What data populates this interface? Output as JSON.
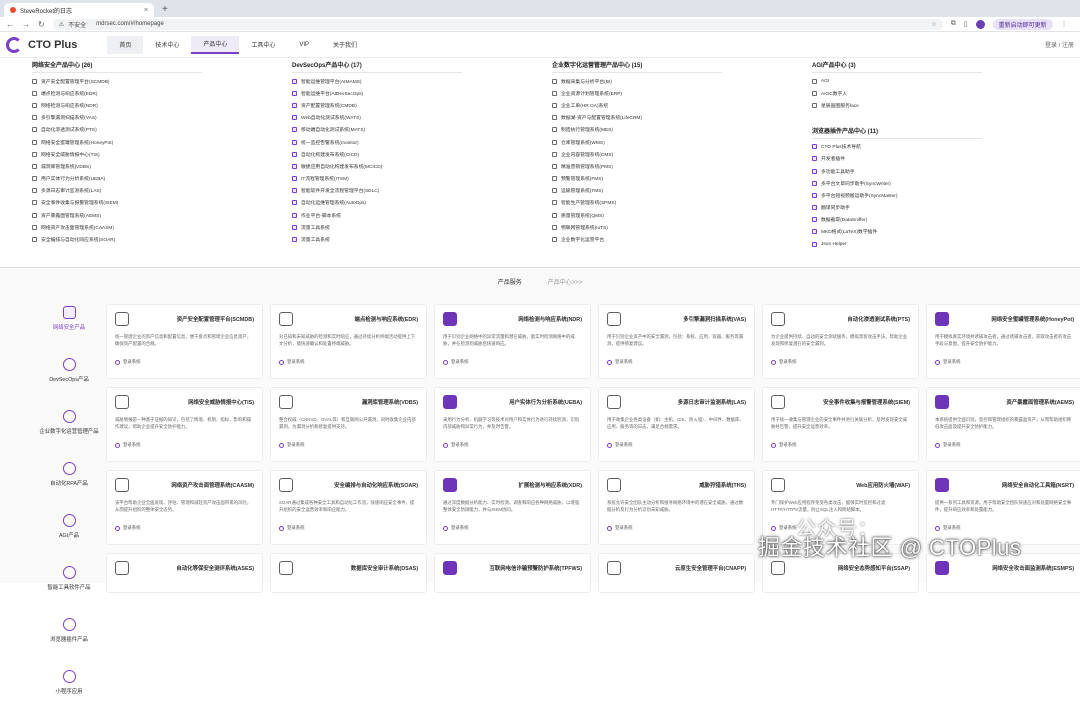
{
  "browser": {
    "tab_title": "SteveRocket的日志",
    "new_tab": "+",
    "security": "不安全",
    "url": "mdrsec.com/#/homepage",
    "update_label": "重新启动即可更新"
  },
  "header": {
    "logo_text": "CTO Plus",
    "menu": [
      "首页",
      "技术中心",
      "产品中心",
      "工具中心",
      "VIP",
      "关于我们"
    ],
    "auth": "登录 / 注册"
  },
  "mega": {
    "col1": {
      "title": "网络安全产品中心 (26)",
      "items": [
        "资产安全配置管理平台(SCMDB)",
        "端点检测与响应系统(EDR)",
        "网络检测与响应系统(NDR)",
        "多引擎漏洞扫描系统(VAS)",
        "自动化渗透测试系统(PTS)",
        "网络安全蜜罐管理系统(HoneyPot)",
        "网络安全威胁情报中心(TIS)",
        "漏洞库管理系统(VDBS)",
        "用户实体行为分析系统(UEBA)",
        "多源日志审计监测系统(LAS)",
        "安全事件收集与报警管理系统(SIEM)",
        "资产暴露面管理系统(AEMS)",
        "网络资产攻击面管理系统(CAASM)",
        "安全编排与自动化响应系统(SOAR)"
      ]
    },
    "col2": {
      "title": "DevSecOps产品中心 (17)",
      "items": [
        "智能运维管理平台(AIMAMS)",
        "智能运维平台(AIDevSecOps)",
        "资产配置管理系统(CMDB)",
        "Web自动化测试系统(WATS)",
        "移动端自动化测试系统(MATS)",
        "统一监控告警系统(monitor)",
        "自动化构建发布系统(CICD)",
        "敏捷应用自动化构建发布系统(MCICD)",
        "IT流程管理系统(ITSM)",
        "智能软件开发全流程管理平台(SDLC)",
        "自动化运维管理系统(AutoOps)",
        "作业平台-脚本系统",
        "流量工具系统",
        "流量工具系统"
      ]
    },
    "col3": {
      "title": "企业数字化运营管理产品中心 (15)",
      "items": [
        "数据采集与分析平台(BI)",
        "企业资源计划管理系统(ERP)",
        "企业工单(HR OA)系统",
        "数据湖-资产与配置管理系统(LifeCRM)",
        "制造执行管理系统(MES)",
        "仓库管理系统(WMS)",
        "企业内容管理系统(CMS)",
        "精准营销管理系统(PMS)",
        "预警管理系统(FMS)",
        "运输管理系统(TMS)",
        "智能生产管理系统(SPMS)",
        "质量管理系统(QMS)",
        "物联网管理系统(IoTS)",
        "企业数字化运营平台"
      ]
    },
    "col4": {
      "title": "AGI产品中心 (3)",
      "items": [
        "AGI",
        "AIGC数字人",
        "星辰画图服务face"
      ],
      "title2": "浏览器插件产品中心 (11)",
      "items2": [
        "CTO Plus技术导航",
        "开发者插件",
        "多功能工具助手",
        "多平台文章同步助手(SyncWriter)",
        "多平台短视频搬运助手(SyncMaster)",
        "翻译同步助手",
        "数据截取(DataSniffer)",
        "MKD格式(LaTeX)数学插件",
        "Json Helper"
      ]
    }
  },
  "services": {
    "tabs": [
      "产品服务",
      "产品中心>>>"
    ],
    "sidebar": [
      "网络安全产品",
      "DevSecOps产品",
      "企业数字化运营管理产品",
      "自动化RPA产品",
      "AGI产品",
      "智能工具软件产品",
      "浏览器插件产品",
      "小程序应用"
    ],
    "login_label": "登录系统",
    "cards": [
      {
        "name": "资产安全配置管理平台(SCMDB)",
        "desc": "统一管理企业的资产信息和配置信息，便于盘点和管理企业信息资产，确保资产配置的合规。"
      },
      {
        "name": "端点检测与响应系统(EDR)",
        "desc": "对已知和未知威胁的检测和实时响应，通过持续分析终端活动提供上下文分析，能快速确认和处置终端威胁。"
      },
      {
        "name": "网络检测与响应系统(NDR)",
        "desc": "用于识别企业网络中的异常流量和潜在威胁，能实时检测网络中的威胁，并在检测到威胁后快速响应。"
      },
      {
        "name": "多引擎漏洞扫描系统(VAS)",
        "desc": "用于识别企业资产中的安全漏洞，包括：系统、应用、容器、服务等漏洞，提供修复建议。"
      },
      {
        "name": "自动化渗透测试系统(PTS)",
        "desc": "为企业提供持续、自动的安全测试服务，模拟黑客攻击手法，帮助企业发现和修复潜在的安全漏洞。"
      },
      {
        "name": "网络安全蜜罐管理系统(HoneyPot)",
        "desc": "用于模拟真实环境并诱捕攻击者，通过诱捕攻击者，获取攻击者的攻击手段与意图，提升安全防护能力。"
      },
      {
        "name": "网络安全威胁情报中心(TIS)",
        "desc": "威胁情报是一种基于证据的知识，包括了情境、机制、指标、影响和操作建议，帮助企业提升安全防护能力。"
      },
      {
        "name": "漏洞库管理系统(VDBS)",
        "desc": "整合权威（CNNVD、OVAL等）和互联网公开漏洞，同时收集企业内部漏洞，为漏洞分析和修复提供支持。"
      },
      {
        "name": "用户实体行为分析系统(UEBA)",
        "desc": "采用行为分析、机器学习等技术对用户和实体行为进行持续检测，识别内部威胁和异常行为，并及时告警。"
      },
      {
        "name": "多源日志审计监测系统(LAS)",
        "desc": "用于收集企业各类设备（如：主机、IDS、防火墙）、中间件、数据库、应用、服务等的日志，满足合规需求。"
      },
      {
        "name": "安全事件收集与报警管理系统(SIEM)",
        "desc": "用于统一收集与管理企业的安全事件并进行关联分析，及时发现安全威胁并告警，提升安全运营效率。"
      },
      {
        "name": "资产暴露面管理系统(AEMS)",
        "desc": "本系统提供全面识别，监控和管理组织的暴露面资产，从而帮助组织降低攻击面及提升安全防护能力。"
      },
      {
        "name": "网络资产攻击面管理系统(CAASM)",
        "desc": "该平台帮助企业全面发现、评估、管理和减轻资产攻击面带来的风险，从而提升组织的整体安全态势。"
      },
      {
        "name": "安全编排与自动化响应系统(SOAR)",
        "desc": "SOAR通过集成各种安全工具和自动化工作流，快速响应安全事件，提升组织的安全运营效率和响应能力。"
      },
      {
        "name": "扩展检测与响应系统(XDR)",
        "desc": "通过深度数据分析能力、实时检测、调查和响应各种网络威胁，以增强整体安全防御能力，并与SIEM协同。"
      },
      {
        "name": "威胁狩猎系统(THS)",
        "desc": "系统允许安全团队主动分析和搜寻网络环境中的潜在安全威胁，通过数据分析及行为分析识别未知威胁。"
      },
      {
        "name": "Web应用防火墙(WAF)",
        "desc": "专门保护Web应用程序免受各类攻击，能够实时监控和过滤HTTP/HTTPS流量，防止SQL注入和跨站脚本。"
      },
      {
        "name": "网络安全自动化工具箱(NSRT)",
        "desc": "提供一系列工具和资源，用于帮助安全团队快速应对和处置网络安全事件，提升响应效率和处置能力。"
      },
      {
        "name": "自动化等保安全测评系统(ASES)",
        "desc": ""
      },
      {
        "name": "数据库安全审计系统(DSAS)",
        "desc": ""
      },
      {
        "name": "互联网电信诈骗预警防护系统(TPFWS)",
        "desc": ""
      },
      {
        "name": "云原生安全管理平台(CNAPP)",
        "desc": ""
      },
      {
        "name": "网络安全态势感知平台(SSAP)",
        "desc": ""
      },
      {
        "name": "网络安全攻击面监测系统(ESMPS)",
        "desc": ""
      }
    ]
  },
  "watermark": {
    "line1": "公众号：",
    "line2": "掘金技术社区 @ CTOPlus"
  }
}
